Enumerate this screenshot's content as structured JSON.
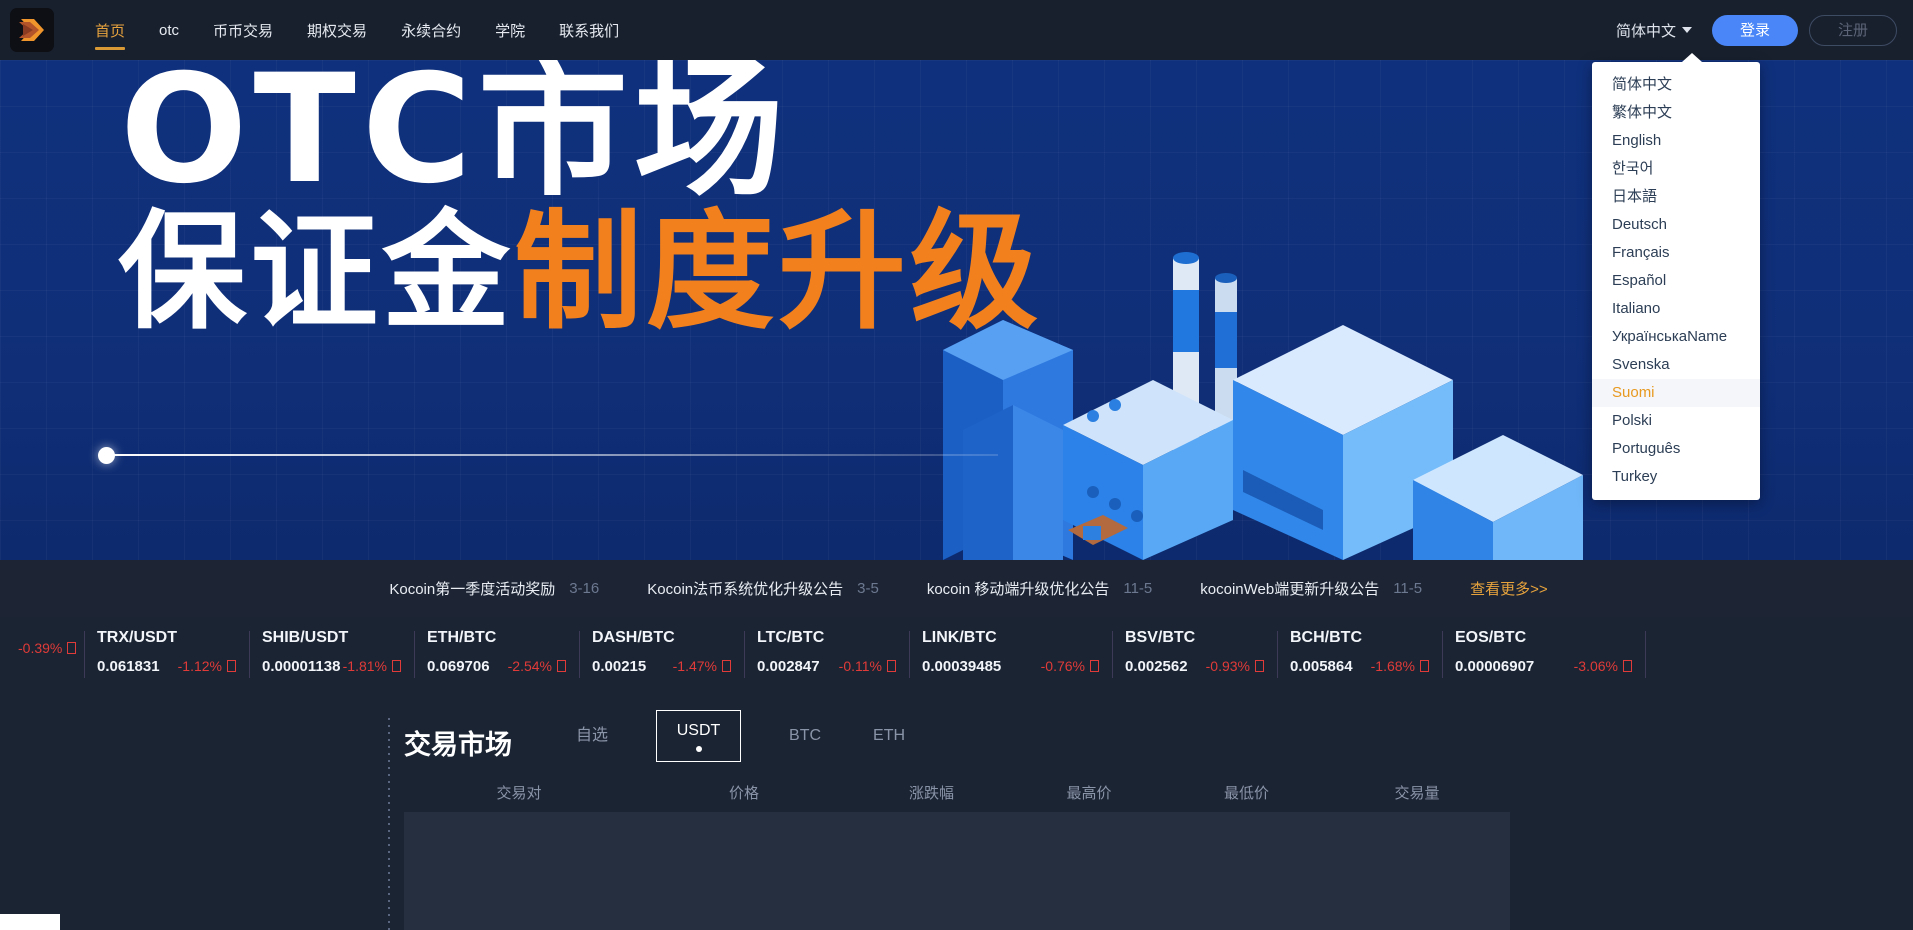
{
  "header": {
    "logo_name": "kocoin-logo",
    "nav": [
      {
        "label": "首页",
        "active": true
      },
      {
        "label": "otc",
        "active": false
      },
      {
        "label": "币币交易",
        "active": false
      },
      {
        "label": "期权交易",
        "active": false
      },
      {
        "label": "永续合约",
        "active": false
      },
      {
        "label": "学院",
        "active": false
      },
      {
        "label": "联系我们",
        "active": false
      }
    ],
    "language_selected": "简体中文",
    "login_label": "登录",
    "register_label": "注册",
    "accent_orange": "#e8a33d",
    "login_blue": "#4a86f7"
  },
  "language_menu": {
    "options": [
      {
        "label": "简体中文",
        "hover": false
      },
      {
        "label": "繁体中文",
        "hover": false
      },
      {
        "label": "English",
        "hover": false
      },
      {
        "label": "한국어",
        "hover": false
      },
      {
        "label": "日本語",
        "hover": false
      },
      {
        "label": "Deutsch",
        "hover": false
      },
      {
        "label": "Français",
        "hover": false
      },
      {
        "label": "Español",
        "hover": false
      },
      {
        "label": "Italiano",
        "hover": false
      },
      {
        "label": "УкраїнськаName",
        "hover": false
      },
      {
        "label": "Svenska",
        "hover": false
      },
      {
        "label": "Suomi",
        "hover": true
      },
      {
        "label": "Polski",
        "hover": false
      },
      {
        "label": "Português",
        "hover": false
      },
      {
        "label": "Turkey",
        "hover": false
      }
    ],
    "hover_color": "#e8991f"
  },
  "banner": {
    "line1": "OTC市场",
    "line2_white": "保证金",
    "line2_orange": "制度升级",
    "background_blue": "#10307b",
    "strip_orange": "#f4731f"
  },
  "news": {
    "items": [
      {
        "title": "Kocoin第一季度活动奖励",
        "date": "3-16"
      },
      {
        "title": "Kocoin法币系统优化升级公告",
        "date": "3-5"
      },
      {
        "title": "kocoin 移动端升级优化公告",
        "date": "11-5"
      },
      {
        "title": "kocoinWeb端更新升级公告",
        "date": "11-5"
      }
    ],
    "more_label": "查看更多>>"
  },
  "ticker": {
    "down_color": "#e03b38",
    "items": [
      {
        "pair": "",
        "price": "",
        "change": "-0.39%",
        "partial": true
      },
      {
        "pair": "TRX/USDT",
        "price": "0.061831",
        "change": "-1.12%",
        "partial": false
      },
      {
        "pair": "SHIB/USDT",
        "price": "0.00001138",
        "change": "-1.81%",
        "partial": false
      },
      {
        "pair": "ETH/BTC",
        "price": "0.069706",
        "change": "-2.54%",
        "partial": false
      },
      {
        "pair": "DASH/BTC",
        "price": "0.00215",
        "change": "-1.47%",
        "partial": false
      },
      {
        "pair": "LTC/BTC",
        "price": "0.002847",
        "change": "-0.11%",
        "partial": false
      },
      {
        "pair": "LINK/BTC",
        "price": "0.00039485",
        "change": "-0.76%",
        "partial": false
      },
      {
        "pair": "BSV/BTC",
        "price": "0.002562",
        "change": "-0.93%",
        "partial": false
      },
      {
        "pair": "BCH/BTC",
        "price": "0.005864",
        "change": "-1.68%",
        "partial": false
      },
      {
        "pair": "EOS/BTC",
        "price": "0.00006907",
        "change": "-3.06%",
        "partial": false
      }
    ]
  },
  "market": {
    "title": "交易市场",
    "tabs": [
      {
        "label": "自选",
        "selected": false
      },
      {
        "label": "USDT",
        "selected": true
      },
      {
        "label": "BTC",
        "selected": false
      },
      {
        "label": "ETH",
        "selected": false
      }
    ],
    "columns": [
      "交易对",
      "价格",
      "涨跌幅",
      "最高价",
      "最低价",
      "交易量"
    ]
  }
}
